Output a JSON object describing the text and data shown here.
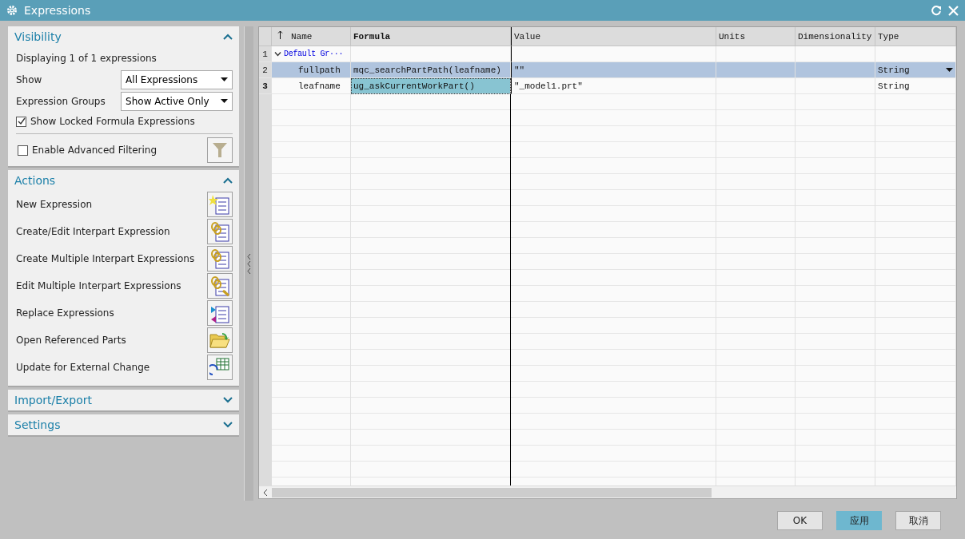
{
  "window": {
    "title": "Expressions"
  },
  "visibility": {
    "title": "Visibility",
    "expanded": true,
    "summary": "Displaying 1 of 1 expressions",
    "fields": [
      {
        "label": "Show",
        "value": "All Expressions"
      },
      {
        "label": "Expression Groups",
        "value": "Show Active Only"
      }
    ],
    "locked": {
      "label": "Show Locked Formula Expressions",
      "checked": true
    },
    "advanced": {
      "label": "Enable Advanced Filtering",
      "checked": false
    }
  },
  "actions": {
    "title": "Actions",
    "expanded": true,
    "items": [
      {
        "label": "New Expression",
        "kind": "new"
      },
      {
        "label": "Create/Edit Interpart Expression",
        "kind": "link"
      },
      {
        "label": "Create Multiple Interpart Expressions",
        "kind": "multi"
      },
      {
        "label": "Edit Multiple Interpart Expressions",
        "kind": "edit"
      },
      {
        "label": "Replace Expressions",
        "kind": "replace"
      },
      {
        "label": "Open Referenced Parts",
        "kind": "folder"
      },
      {
        "label": "Update for External Change",
        "kind": "update"
      }
    ]
  },
  "collapsed_panels": [
    {
      "title": "Import/Export",
      "expanded": false
    },
    {
      "title": "Settings",
      "expanded": false
    }
  ],
  "table": {
    "columns": [
      "Name",
      "Formula",
      "Value",
      "Units",
      "Dimensionality",
      "Type"
    ],
    "rows": [
      {
        "number": "1",
        "kind": "group",
        "name": "Default Gr···",
        "expanded": true,
        "selected": false,
        "current": false
      },
      {
        "number": "2",
        "kind": "item",
        "name": "fullpath",
        "formula": "mqc_searchPartPath(leafname)",
        "value": "\"\"",
        "type": "String",
        "selected": true,
        "current": false
      },
      {
        "number": "3",
        "kind": "item",
        "name": "leafname",
        "formula": "ug_askCurrentWorkPart()",
        "value": "\"_model1.prt\"",
        "type": "String",
        "selected": false,
        "current": true
      }
    ]
  },
  "buttons": [
    {
      "label": "OK",
      "selected": false
    },
    {
      "label": "应用",
      "selected": true
    },
    {
      "label": "取消",
      "selected": false
    }
  ]
}
